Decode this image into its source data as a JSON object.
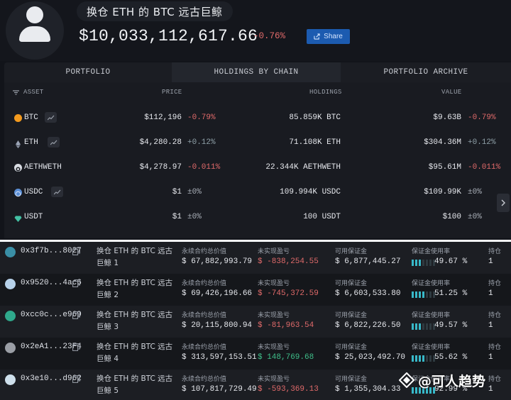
{
  "header": {
    "title": "换仓 ETH 的 BTC 远古巨鲸",
    "total_value": "$10,033,112,617.66",
    "total_change": "-0.76%",
    "share_label": "Share"
  },
  "tabs": [
    {
      "label": "PORTFOLIO"
    },
    {
      "label": "HOLDINGS BY CHAIN"
    },
    {
      "label": "PORTFOLIO ARCHIVE"
    }
  ],
  "columns": {
    "asset": "ASSET",
    "price": "PRICE",
    "holdings": "HOLDINGS",
    "value": "VALUE"
  },
  "assets": [
    {
      "symbol": "BTC",
      "icon": "btc-coin-icon",
      "color": "#f39a1e",
      "price": "$112,196",
      "price_change": "-0.79%",
      "holdings": "85.859K BTC",
      "value": "$9.63B",
      "value_change": "-0.79%"
    },
    {
      "symbol": "ETH",
      "icon": "eth-coin-icon",
      "color": "#9aa3b5",
      "price": "$4,280.28",
      "price_change": "+0.12%",
      "holdings": "71.108K ETH",
      "value": "$304.36M",
      "value_change": "+0.12%"
    },
    {
      "symbol": "AETHWETH",
      "icon": "aave-coin-icon",
      "color": "#d9dde3",
      "price": "$4,278.97",
      "price_change": "-0.011%",
      "holdings": "22.344K AETHWETH",
      "value": "$95.61M",
      "value_change": "-0.011%"
    },
    {
      "symbol": "USDC",
      "icon": "usdc-coin-icon",
      "color": "#5b8fd6",
      "price": "$1",
      "price_change": "±0%",
      "holdings": "109.994K USDC",
      "value": "$109.99K",
      "value_change": "±0%"
    },
    {
      "symbol": "USDT",
      "icon": "usdt-coin-icon",
      "color": "#43c1a4",
      "price": "$1",
      "price_change": "±0%",
      "holdings": "100 USDT",
      "value": "$100",
      "value_change": "±0%"
    }
  ],
  "whale_labels": {
    "perp_value": "永续合约总价值",
    "unrealized_pnl": "未实现盈亏",
    "available_margin": "可用保证金",
    "margin_usage": "保证金使用率",
    "positions": "持仓"
  },
  "whales": [
    {
      "address": "0x3f7b...8027",
      "name": "换仓 ETH 的 BTC 远古巨鲸 1",
      "perp_value": "$ 67,882,993.79",
      "pnl": "$ -838,254.55",
      "pnl_sign": "neg",
      "margin": "$ 6,877,445.27",
      "usage": "49.67 %",
      "usage_level": 0.4967,
      "positions": "1"
    },
    {
      "address": "0x9520...4ac6",
      "name": "换仓 ETH 的 BTC 远古巨鲸 2",
      "perp_value": "$ 69,426,196.66",
      "pnl": "$ -745,372.59",
      "pnl_sign": "neg",
      "margin": "$ 6,603,533.80",
      "usage": "51.25 %",
      "usage_level": 0.5125,
      "positions": "1"
    },
    {
      "address": "0xcc0c...e969",
      "name": "换仓 ETH 的 BTC 远古巨鲸 3",
      "perp_value": "$ 20,115,800.94",
      "pnl": "$ -81,963.54",
      "pnl_sign": "neg",
      "margin": "$ 6,822,226.50",
      "usage": "49.57 %",
      "usage_level": 0.4957,
      "positions": "1"
    },
    {
      "address": "0x2eA1...23F4",
      "name": "换仓 ETH 的 BTC 远古巨鲸 4",
      "perp_value": "$ 313,597,153.51",
      "pnl": "$ 148,769.68",
      "pnl_sign": "pos",
      "margin": "$ 25,023,492.70",
      "usage": "55.62 %",
      "usage_level": 0.5562,
      "positions": "1"
    },
    {
      "address": "0x3e10...d962",
      "name": "换仓 ETH 的 BTC 远古巨鲸 5",
      "perp_value": "$ 107,817,729.49",
      "pnl": "$ -593,369.13",
      "pnl_sign": "neg",
      "margin": "$ 1,355,304.33",
      "usage": "92.99 %",
      "usage_level": 0.9299,
      "positions": "1"
    }
  ],
  "watermark": {
    "text": "@可人趋势"
  }
}
